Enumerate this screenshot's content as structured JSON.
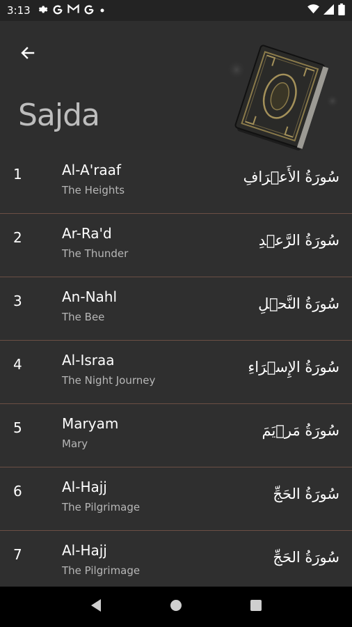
{
  "status_bar": {
    "time": "3:13",
    "left_icons": [
      "gear-icon",
      "google-g-icon",
      "gmail-icon",
      "google-g-icon",
      "dot-icon"
    ],
    "right_icons": [
      "wifi-icon",
      "signal-icon",
      "battery-icon"
    ]
  },
  "header": {
    "title": "Sajda",
    "back_icon": "arrow-left-icon"
  },
  "surahs": [
    {
      "number": "1",
      "name": "Al-A'raaf",
      "meaning": "The Heights",
      "arabic": "سُورَةُ الأَعۡرَافِ"
    },
    {
      "number": "2",
      "name": "Ar-Ra'd",
      "meaning": "The Thunder",
      "arabic": "سُورَةُ الرَّعۡدِ"
    },
    {
      "number": "3",
      "name": "An-Nahl",
      "meaning": "The Bee",
      "arabic": "سُورَةُ النَّحۡلِ"
    },
    {
      "number": "4",
      "name": "Al-Israa",
      "meaning": "The Night Journey",
      "arabic": "سُورَةُ الإِسۡرَاءِ"
    },
    {
      "number": "5",
      "name": "Maryam",
      "meaning": "Mary",
      "arabic": "سُورَةُ مَرۡيَمَ"
    },
    {
      "number": "6",
      "name": "Al-Hajj",
      "meaning": "The Pilgrimage",
      "arabic": "سُورَةُ الحَجِّ"
    },
    {
      "number": "7",
      "name": "Al-Hajj",
      "meaning": "The Pilgrimage",
      "arabic": "سُورَةُ الحَجِّ"
    }
  ],
  "colors": {
    "background": "#2f2f2f",
    "divider": "#6b4f44",
    "status_bar": "#232323",
    "nav_bar": "#000000"
  }
}
